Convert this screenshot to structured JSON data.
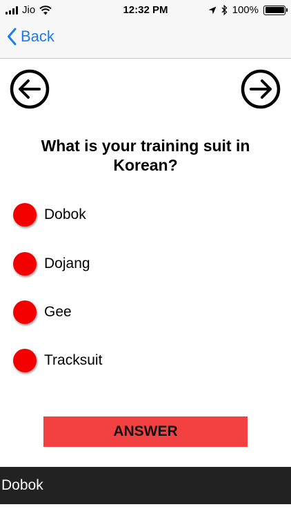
{
  "status_bar": {
    "carrier": "Jio",
    "time": "12:32 PM",
    "battery": "100%",
    "icons": [
      "signal-icon",
      "wifi-icon",
      "location-arrow-icon",
      "bluetooth-icon",
      "battery-icon"
    ]
  },
  "nav": {
    "back_label": "Back",
    "accent_color": "#1a7cf0"
  },
  "question": {
    "text": "What is your training suit in Korean?"
  },
  "options": [
    {
      "label": "Dobok"
    },
    {
      "label": "Dojang"
    },
    {
      "label": "Gee"
    },
    {
      "label": "Tracksuit"
    }
  ],
  "answer_button": {
    "label": "ANSWER",
    "color": "#f34040"
  },
  "bottom_bar": {
    "text": "Dobok"
  },
  "colors": {
    "radio": "#f40000",
    "bottom_bar_bg": "#222222"
  },
  "arrows": {
    "prev_icon": "arrow-left-circle-icon",
    "next_icon": "arrow-right-circle-icon"
  }
}
